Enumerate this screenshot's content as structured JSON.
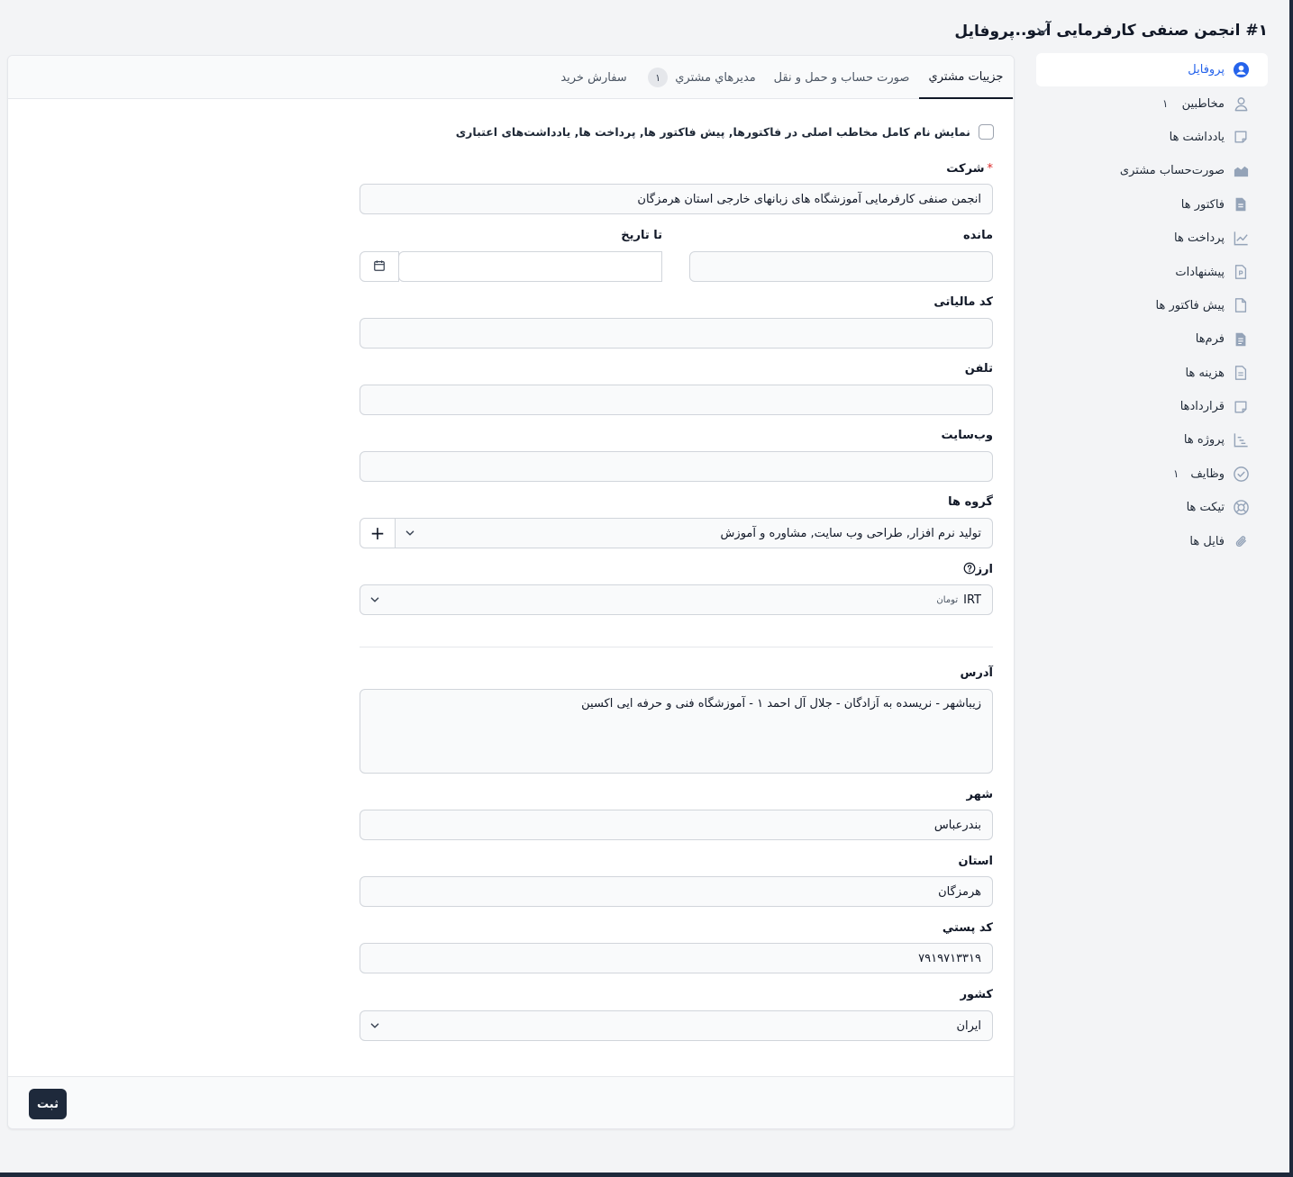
{
  "header": {
    "customer_title": "#۱ انجمن صنفی کارفرمایی آمو...",
    "page_title": "پروفایل"
  },
  "sidebar": {
    "items": [
      {
        "label": "پروفایل",
        "icon": "user-circle-icon",
        "active": true,
        "badge": ""
      },
      {
        "label": "مخاطبین",
        "icon": "user-icon",
        "badge": "۱"
      },
      {
        "label": "یادداشت ها",
        "icon": "note-icon",
        "badge": ""
      },
      {
        "label": "صورت‌حساب مشتری",
        "icon": "area-chart-icon",
        "badge": ""
      },
      {
        "label": "فاکتور ها",
        "icon": "document-icon",
        "badge": ""
      },
      {
        "label": "پرداخت ها",
        "icon": "line-chart-icon",
        "badge": ""
      },
      {
        "label": "پیشنهادات",
        "icon": "proposal-icon",
        "badge": ""
      },
      {
        "label": "پیش فاکتور ها",
        "icon": "document-outline-icon",
        "badge": ""
      },
      {
        "label": "فرم‌ها",
        "icon": "form-icon",
        "badge": ""
      },
      {
        "label": "هزینه ها",
        "icon": "expense-icon",
        "badge": ""
      },
      {
        "label": "قراردادها",
        "icon": "contract-icon",
        "badge": ""
      },
      {
        "label": "پروژه ها",
        "icon": "project-chart-icon",
        "badge": ""
      },
      {
        "label": "وظایف",
        "icon": "check-circle-icon",
        "badge": "۱"
      },
      {
        "label": "تیکت ها",
        "icon": "lifebuoy-icon",
        "badge": ""
      },
      {
        "label": "فایل ها",
        "icon": "paperclip-icon",
        "badge": ""
      }
    ]
  },
  "tabs": [
    {
      "label": "جزييات مشتري",
      "active": true
    },
    {
      "label": "صورت حساب و حمل و نقل"
    },
    {
      "label": "مديرهاي مشتري",
      "badge": "۱"
    },
    {
      "label": "سفارش خريد"
    }
  ],
  "form": {
    "show_full_name_label": "نمایش نام کامل مخاطب اصلی در فاکتورها, پیش فاکتور ها, پرداخت ها, یادداشت‌های اعتباری",
    "company_label": "شرکت",
    "company_value": "انجمن صنفی کارفرمایی آموزشگاه های زبانهای خارجی استان هرمزگان",
    "balance_label": "مانده",
    "balance_value": "",
    "to_date_label": "تا تاریخ",
    "to_date_value": "",
    "tax_code_label": "کد مالیاتی",
    "tax_code_value": "",
    "phone_label": "تلفن",
    "phone_value": "",
    "website_label": "وب‌سایت",
    "website_value": "",
    "groups_label": "گروه ها",
    "groups_value": "تولید نرم افزار, طراحی وب سایت, مشاوره و آموزش",
    "currency_label": "ارز",
    "currency_value": "IRT",
    "currency_sub": "تومان",
    "address_label": "آدرس",
    "address_value": "زیباشهر - نریسده به آزادگان - جلال آل احمد ۱ - آموزشگاه فنی و حرفه ایی اکسین",
    "city_label": "شهر",
    "city_value": "بندرعباس",
    "state_label": "استان",
    "state_value": "هرمزگان",
    "zip_label": "کد پستي",
    "zip_value": "۷۹۱۹۷۱۳۳۱۹",
    "country_label": "کشور",
    "country_value": "ایران",
    "save_label": "ثبت"
  },
  "colors": {
    "accent": "#2563eb",
    "button_dark": "#1e293b",
    "required": "#dc2626"
  }
}
